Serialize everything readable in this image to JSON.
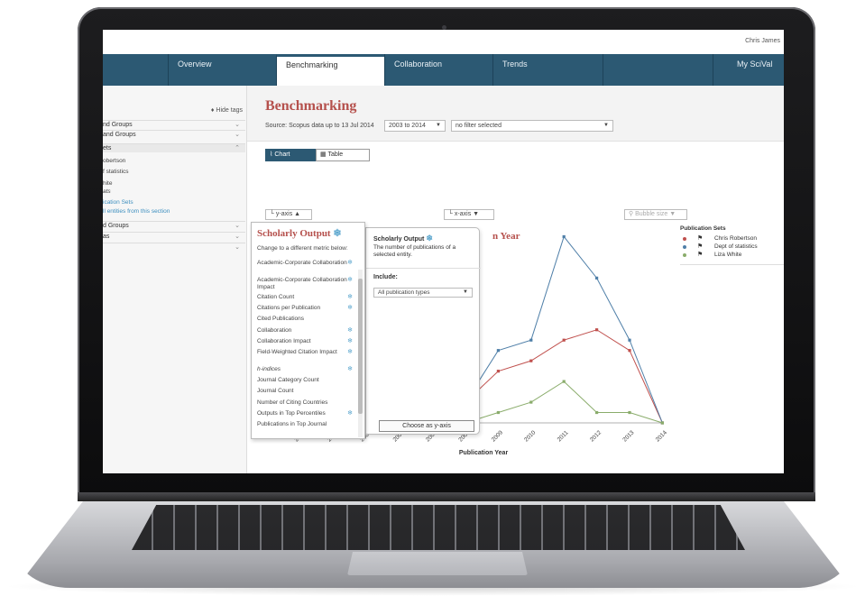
{
  "user": {
    "name": "Chris James"
  },
  "nav": {
    "tabs": [
      "Overview",
      "Benchmarking",
      "Collaboration",
      "Trends",
      "",
      "My SciVal"
    ]
  },
  "sidebar": {
    "hide_tags": "Hide tags",
    "rows": [
      "nd Groups",
      "and Groups",
      "ets"
    ],
    "items": [
      "obertson",
      "f statistics",
      "hite",
      "ats"
    ],
    "links": [
      "ication Sets",
      "ll entities from this section"
    ],
    "rows2": [
      "d Groups",
      "as"
    ]
  },
  "main": {
    "title": "Benchmarking",
    "source": "Source: Scopus data up to 13 Jul 2014",
    "year_range": "2003 to 2014",
    "filter": "no filter selected",
    "chart_toggle": "Chart",
    "table_toggle": "Table",
    "yaxis_btn": "y-axis",
    "xaxis_btn": "x-axis",
    "bubble_btn": "Bubble size",
    "chart_heading_fragment": "n Year"
  },
  "dropdown": {
    "title": "Scholarly Output",
    "subtitle": "Change to a different metric below:",
    "items": [
      {
        "label": "Academic-Corporate Collaboration",
        "snow": true
      },
      {
        "label": "Academic-Corporate Collaboration Impact",
        "snow": true
      },
      {
        "label": "Citation Count",
        "snow": true
      },
      {
        "label": "Citations per Publication",
        "snow": true
      },
      {
        "label": "Cited Publications",
        "snow": false
      },
      {
        "label": "Collaboration",
        "snow": true
      },
      {
        "label": "Collaboration Impact",
        "snow": true
      },
      {
        "label": "Field-Weighted Citation Impact",
        "snow": true
      },
      {
        "label": "h-indices",
        "snow": true
      },
      {
        "label": "Journal Category Count",
        "snow": false
      },
      {
        "label": "Journal Count",
        "snow": false
      },
      {
        "label": "Number of Citing Countries",
        "snow": false
      },
      {
        "label": "Outputs in Top Percentiles",
        "snow": true
      },
      {
        "label": "Publications in Top Journal",
        "snow": false
      }
    ]
  },
  "detail": {
    "title": "Scholarly Output",
    "description": "The number of publications of a selected entity.",
    "include_label": "Include:",
    "include_value": "All publication types",
    "choose_button": "Choose as y-axis"
  },
  "legend": {
    "title": "Publication Sets",
    "entries": [
      "Chris Robertson",
      "Dept of statistics",
      "Liza White"
    ]
  },
  "chart_data": {
    "type": "line",
    "xlabel": "Publication Year",
    "x": [
      "2003",
      "2004",
      "2005",
      "2006",
      "2007",
      "2008",
      "2009",
      "2010",
      "2011",
      "2012",
      "2013",
      "2014"
    ],
    "y_tick_visible": "0",
    "series": [
      {
        "name": "Chris Robertson",
        "color": "#c0504d",
        "values": [
          0,
          0,
          0,
          1,
          1,
          2,
          5,
          6,
          8,
          9,
          7,
          0
        ]
      },
      {
        "name": "Dept of statistics",
        "color": "#4f7fa8",
        "values": [
          0,
          0,
          0,
          1,
          1,
          2,
          7,
          8,
          18,
          14,
          8,
          0
        ]
      },
      {
        "name": "Liza White",
        "color": "#8aac6b",
        "values": [
          0,
          0,
          0,
          0,
          0,
          0,
          1,
          2,
          4,
          1,
          1,
          0
        ]
      }
    ]
  },
  "colors": {
    "nav": "#2c5973",
    "title": "#b5504c"
  }
}
